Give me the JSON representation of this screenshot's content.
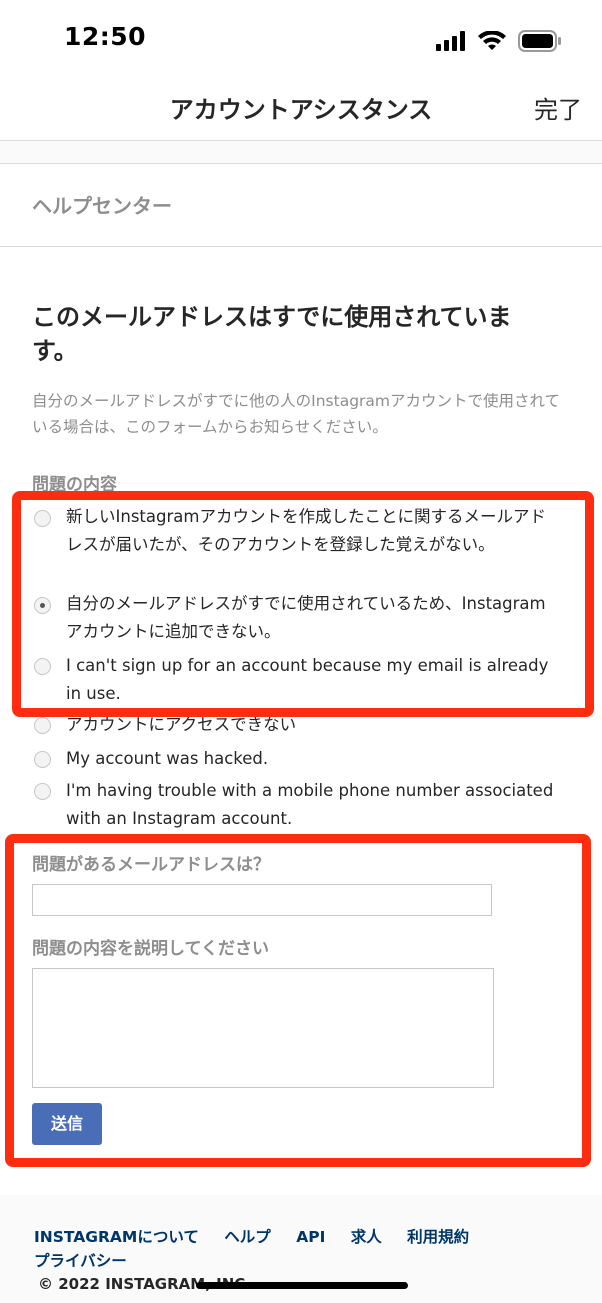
{
  "status_bar": {
    "time": "12:50",
    "icons": [
      "signal-icon",
      "wifi-icon",
      "battery-icon"
    ]
  },
  "nav": {
    "title": "アカウントアシスタンス",
    "done_label": "完了"
  },
  "help_center_link": "ヘルプセンター",
  "form": {
    "headline": "このメールアドレスはすでに使用されています。",
    "intro": "自分のメールアドレスがすでに他の人のInstagramアカウントで使用されている場合は、このフォームからお知らせください。",
    "issue_label": "問題の内容",
    "options": [
      {
        "label": "新しいInstagramアカウントを作成したことに関するメールアドレスが届いたが、そのアカウントを登録した覚えがない。",
        "selected": false
      },
      {
        "label": "自分のメールアドレスがすでに使用されているため、Instagramアカウントに追加できない。",
        "selected": true
      },
      {
        "label": "I can't sign up for an account because my email is already in use.",
        "selected": false
      },
      {
        "label": "アカウントにアクセスできない",
        "selected": false
      },
      {
        "label": "My account was hacked.",
        "selected": false
      },
      {
        "label": "I'm having trouble with a mobile phone number associated with an Instagram account.",
        "selected": false
      }
    ],
    "email_label": "問題があるメールアドレスは？",
    "email_value": "",
    "description_label": "問題の内容を説明してください",
    "description_value": "",
    "submit_label": "送信"
  },
  "footer": {
    "links": [
      "INSTAGRAMについて",
      "ヘルプ",
      "API",
      "求人",
      "利用規約"
    ],
    "privacy": "プライバシー",
    "copyright": "© 2022 INSTAGRAM, INC."
  },
  "colors": {
    "highlight": "#ff2d10",
    "button": "#4a6db7",
    "link": "#003569"
  }
}
